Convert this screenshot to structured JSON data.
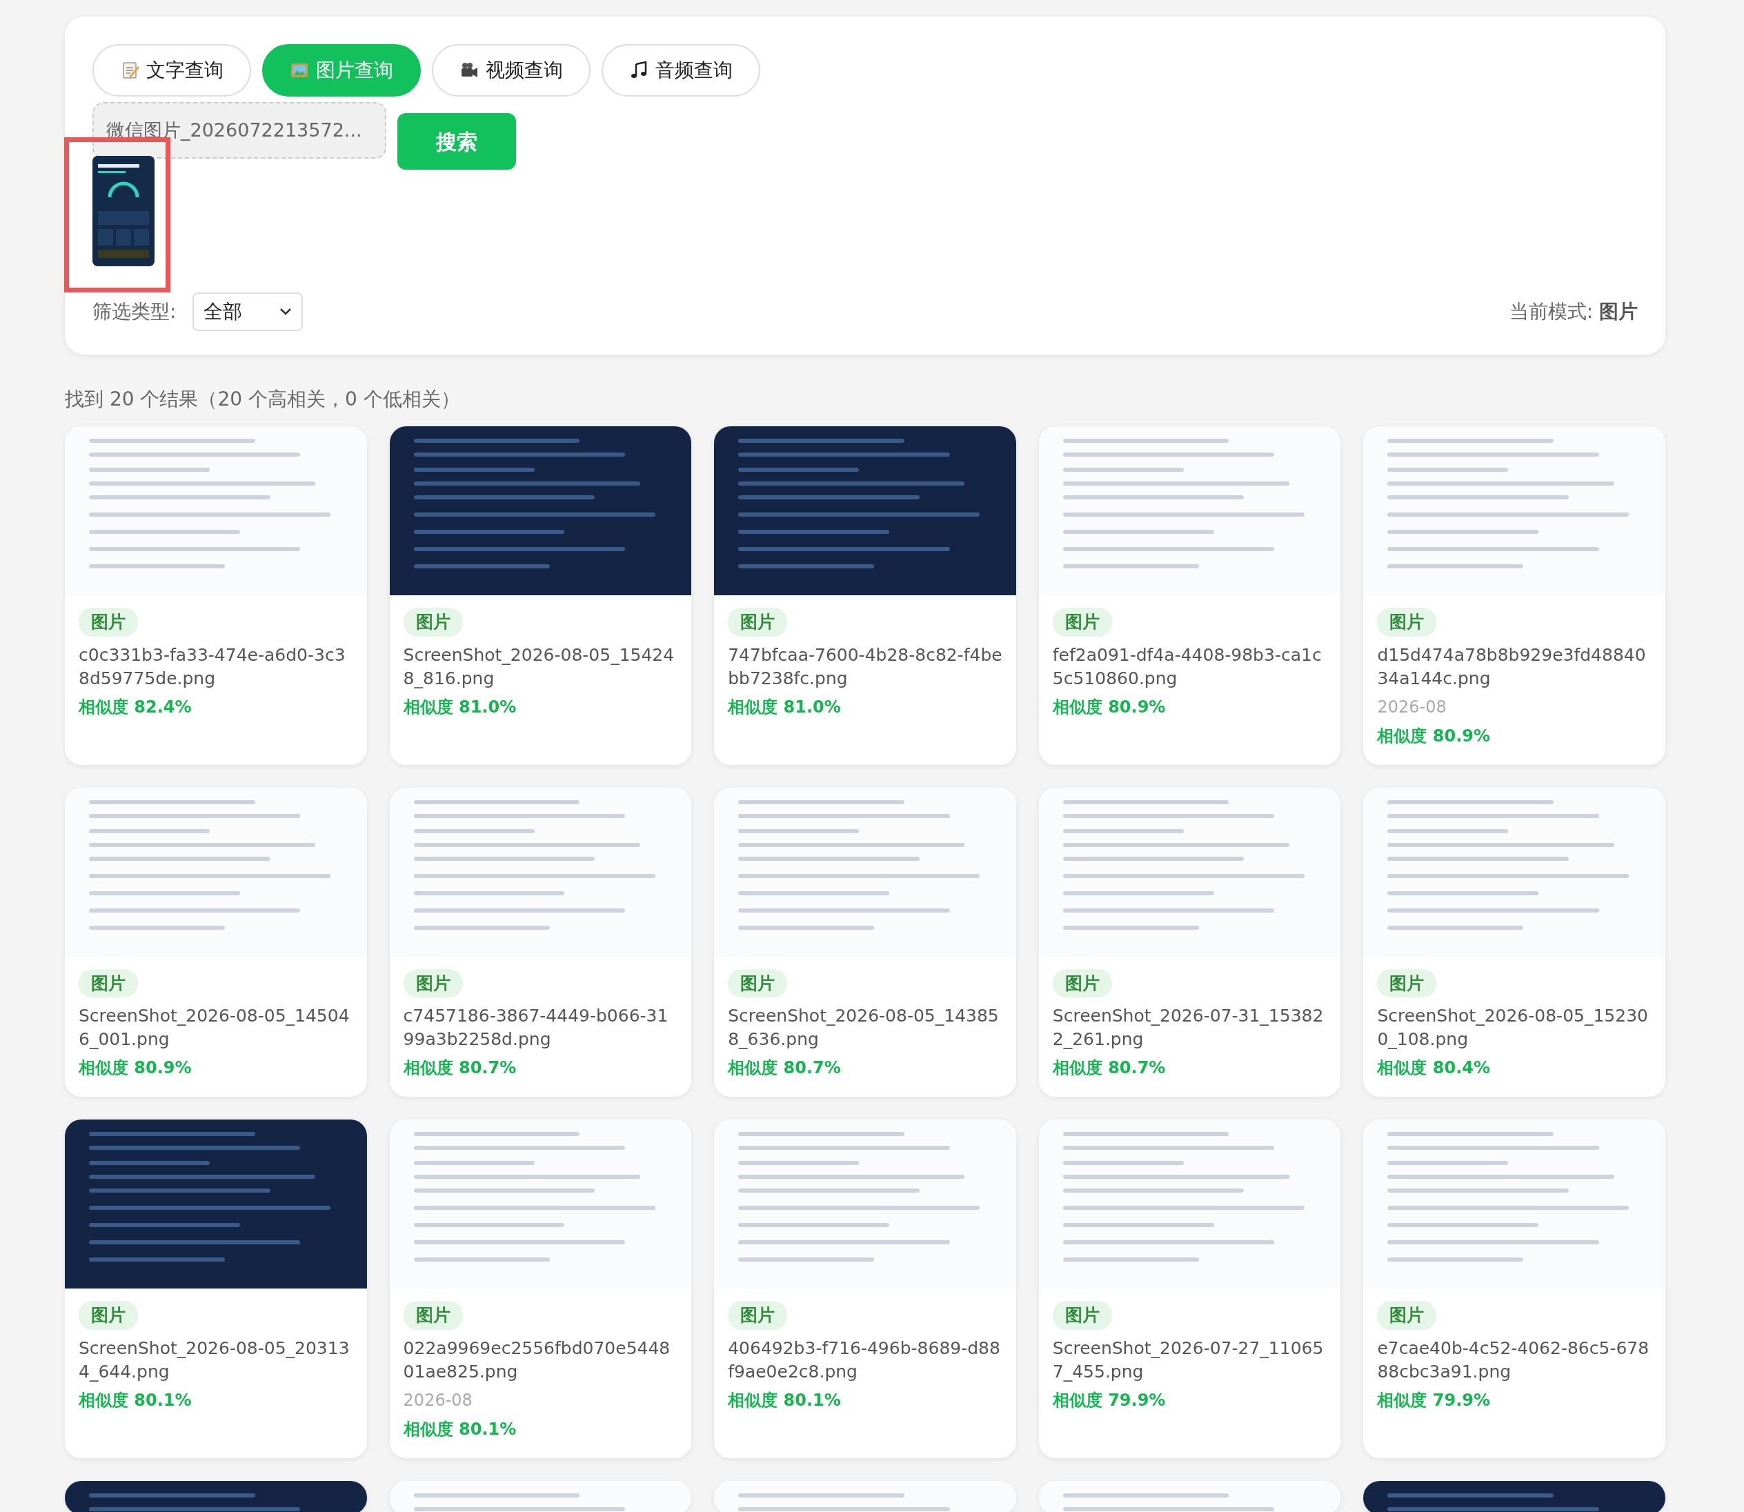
{
  "tabs": [
    {
      "label": "文字查询",
      "selected": false
    },
    {
      "label": "图片查询",
      "selected": true
    },
    {
      "label": "视频查询",
      "selected": false
    },
    {
      "label": "音频查询",
      "selected": false
    }
  ],
  "file_field": {
    "value": "微信图片_2026072213572..."
  },
  "search_button": "搜索",
  "preview": {
    "highlighted": true
  },
  "filter": {
    "label": "筛选类型:",
    "value": "全部"
  },
  "mode": {
    "label": "当前模式:",
    "value": "图片"
  },
  "summary": "找到 20 个结果（20 个高相关，0 个低相关）",
  "results": [
    {
      "kind": "document",
      "type": "图片",
      "filename": "c0c331b3-fa33-474e-a6d0-3c38d59775de.png",
      "similarity": "相似度 82.4%"
    },
    {
      "kind": "dark",
      "type": "图片",
      "filename": "ScreenShot_2026-08-05_154248_816.png",
      "similarity": "相似度 81.0%"
    },
    {
      "kind": "dark",
      "type": "图片",
      "filename": "747bfcaa-7600-4b28-8c82-f4bebb7238fc.png",
      "similarity": "相似度 81.0%"
    },
    {
      "kind": "document",
      "type": "图片",
      "filename": "fef2a091-df4a-4408-98b3-ca1c5c510860.png",
      "similarity": "相似度 80.9%"
    },
    {
      "kind": "document",
      "type": "图片",
      "filename": "d15d474a78b8b929e3fd4884034a144c.png",
      "date": "2026-08",
      "similarity": "相似度 80.9%"
    },
    {
      "kind": "document",
      "type": "图片",
      "filename": "ScreenShot_2026-08-05_145046_001.png",
      "similarity": "相似度 80.9%"
    },
    {
      "kind": "document",
      "type": "图片",
      "filename": "c7457186-3867-4449-b066-3199a3b2258d.png",
      "similarity": "相似度 80.7%"
    },
    {
      "kind": "document",
      "type": "图片",
      "filename": "ScreenShot_2026-08-05_143858_636.png",
      "similarity": "相似度 80.7%"
    },
    {
      "kind": "document",
      "type": "图片",
      "filename": "ScreenShot_2026-07-31_153822_261.png",
      "similarity": "相似度 80.7%"
    },
    {
      "kind": "document",
      "type": "图片",
      "filename": "ScreenShot_2026-08-05_152300_108.png",
      "similarity": "相似度 80.4%"
    },
    {
      "kind": "dark",
      "type": "图片",
      "filename": "ScreenShot_2026-08-05_203134_644.png",
      "similarity": "相似度 80.1%"
    },
    {
      "kind": "document",
      "type": "图片",
      "filename": "022a9969ec2556fbd070e544801ae825.png",
      "date": "2026-08",
      "similarity": "相似度 80.1%"
    },
    {
      "kind": "document",
      "type": "图片",
      "filename": "406492b3-f716-496b-8689-d88f9ae0e2c8.png",
      "similarity": "相似度 80.1%"
    },
    {
      "kind": "document",
      "type": "图片",
      "filename": "ScreenShot_2026-07-27_110657_455.png",
      "similarity": "相似度 79.9%"
    },
    {
      "kind": "document",
      "type": "图片",
      "filename": "e7cae40b-4c52-4062-86c5-67888cbc3a91.png",
      "similarity": "相似度 79.9%"
    },
    {
      "kind": "dark"
    },
    {
      "kind": "document"
    },
    {
      "kind": "document"
    },
    {
      "kind": "document"
    },
    {
      "kind": "dark"
    }
  ]
}
